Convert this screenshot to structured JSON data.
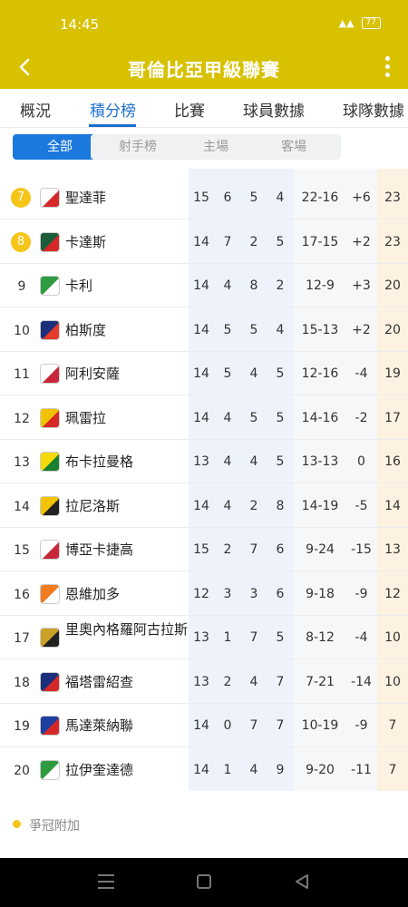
{
  "status": {
    "time": "14:45",
    "battery": "77"
  },
  "header": {
    "title": "哥倫比亞甲級聯賽"
  },
  "tabs": [
    "概況",
    "積分榜",
    "比賽",
    "球員數據",
    "球隊數據"
  ],
  "filters": [
    "全部",
    "射手榜",
    "主場",
    "客場"
  ],
  "rows": [
    {
      "rank": "7",
      "team": "聖達菲",
      "p": "15",
      "w": "6",
      "d": "5",
      "l": "4",
      "gf": "22-16",
      "gd": "+6",
      "pts": "23",
      "logo": [
        "#ffffff",
        "#d62828"
      ]
    },
    {
      "rank": "8",
      "team": "卡達斯",
      "p": "14",
      "w": "7",
      "d": "2",
      "l": "5",
      "gf": "17-15",
      "gd": "+2",
      "pts": "23",
      "logo": [
        "#1d5e3a",
        "#d62828"
      ]
    },
    {
      "rank": "9",
      "team": "卡利",
      "p": "14",
      "w": "4",
      "d": "8",
      "l": "2",
      "gf": "12-9",
      "gd": "+3",
      "pts": "20",
      "logo": [
        "#2e9b3f",
        "#ffffff"
      ]
    },
    {
      "rank": "10",
      "team": "柏斯度",
      "p": "14",
      "w": "5",
      "d": "5",
      "l": "4",
      "gf": "15-13",
      "gd": "+2",
      "pts": "20",
      "logo": [
        "#1c2f7a",
        "#e43b2a"
      ]
    },
    {
      "rank": "11",
      "team": "阿利安薩",
      "p": "14",
      "w": "5",
      "d": "4",
      "l": "5",
      "gf": "12-16",
      "gd": "-4",
      "pts": "19",
      "logo": [
        "#ffffff",
        "#c8263a"
      ]
    },
    {
      "rank": "12",
      "team": "珮雷拉",
      "p": "14",
      "w": "4",
      "d": "5",
      "l": "5",
      "gf": "14-16",
      "gd": "-2",
      "pts": "17",
      "logo": [
        "#f2c200",
        "#d62828"
      ]
    },
    {
      "rank": "13",
      "team": "布卡拉曼格",
      "p": "13",
      "w": "4",
      "d": "4",
      "l": "5",
      "gf": "13-13",
      "gd": "0",
      "pts": "16",
      "logo": [
        "#f5d90a",
        "#1a7f2e"
      ]
    },
    {
      "rank": "14",
      "team": "拉尼洛斯",
      "p": "14",
      "w": "4",
      "d": "2",
      "l": "8",
      "gf": "14-19",
      "gd": "-5",
      "pts": "14",
      "logo": [
        "#f3c200",
        "#222222"
      ]
    },
    {
      "rank": "15",
      "team": "博亞卡捷高",
      "p": "15",
      "w": "2",
      "d": "7",
      "l": "6",
      "gf": "9-24",
      "gd": "-15",
      "pts": "13",
      "logo": [
        "#ffffff",
        "#c8263a"
      ]
    },
    {
      "rank": "16",
      "team": "恩維加多",
      "p": "12",
      "w": "3",
      "d": "3",
      "l": "6",
      "gf": "9-18",
      "gd": "-9",
      "pts": "12",
      "logo": [
        "#f37b20",
        "#ffffff"
      ]
    },
    {
      "rank": "17",
      "team": "里奧內格羅阿古拉斯",
      "p": "13",
      "w": "1",
      "d": "7",
      "l": "5",
      "gf": "8-12",
      "gd": "-4",
      "pts": "10",
      "logo": [
        "#c9a227",
        "#222222"
      ]
    },
    {
      "rank": "18",
      "team": "福塔雷紹查",
      "p": "13",
      "w": "2",
      "d": "4",
      "l": "7",
      "gf": "7-21",
      "gd": "-14",
      "pts": "10",
      "logo": [
        "#1c2f7a",
        "#d62828"
      ]
    },
    {
      "rank": "19",
      "team": "馬達萊納聯",
      "p": "14",
      "w": "0",
      "d": "7",
      "l": "7",
      "gf": "10-19",
      "gd": "-9",
      "pts": "7",
      "logo": [
        "#1c3fa0",
        "#d62828"
      ]
    },
    {
      "rank": "20",
      "team": "拉伊奎達德",
      "p": "14",
      "w": "1",
      "d": "4",
      "l": "9",
      "gf": "9-20",
      "gd": "-11",
      "pts": "7",
      "logo": [
        "#2e9b3f",
        "#ffffff"
      ]
    }
  ],
  "legend": {
    "label": "爭冠附加",
    "color": "#f5c518"
  },
  "colors": {
    "brand": "#d8c100",
    "active_tab": "#1b6fd0",
    "filter_active": "#1b78dd"
  }
}
